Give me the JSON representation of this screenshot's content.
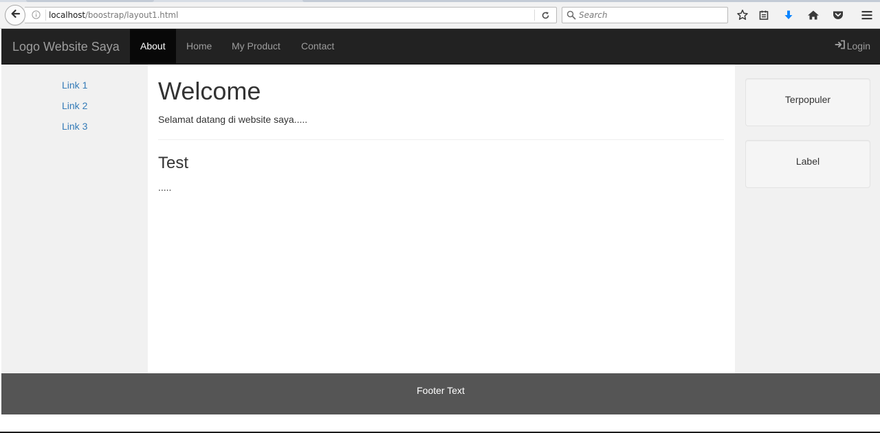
{
  "browser": {
    "url_host": "localhost",
    "url_path": "/boostrap/layout1.html",
    "search_placeholder": "Search",
    "icons": [
      "back-arrow-icon",
      "info-icon",
      "reload-icon",
      "search-icon",
      "star-icon",
      "reading-list-icon",
      "download-icon",
      "home-icon",
      "pocket-icon",
      "menu-icon"
    ]
  },
  "navbar": {
    "brand": "Logo Website Saya",
    "items": [
      {
        "label": "About",
        "active": true
      },
      {
        "label": "Home",
        "active": false
      },
      {
        "label": "My Product",
        "active": false
      },
      {
        "label": "Contact",
        "active": false
      }
    ],
    "login_label": "Login"
  },
  "sidebar_left": {
    "links": [
      "Link 1",
      "Link 2",
      "Link 3"
    ]
  },
  "main": {
    "heading": "Welcome",
    "intro": "Selamat datang di website saya.....",
    "subheading": "Test",
    "subtext": "....."
  },
  "sidebar_right": {
    "wells": [
      "Terpopuler",
      "Label"
    ]
  },
  "footer": {
    "text": "Footer Text"
  },
  "colors": {
    "navbar_bg": "#222222",
    "navbar_active_bg": "#080808",
    "link": "#337ab7",
    "sidebar_bg": "#f1f1f1",
    "footer_bg": "#555555",
    "download_accent": "#0a84ff"
  }
}
